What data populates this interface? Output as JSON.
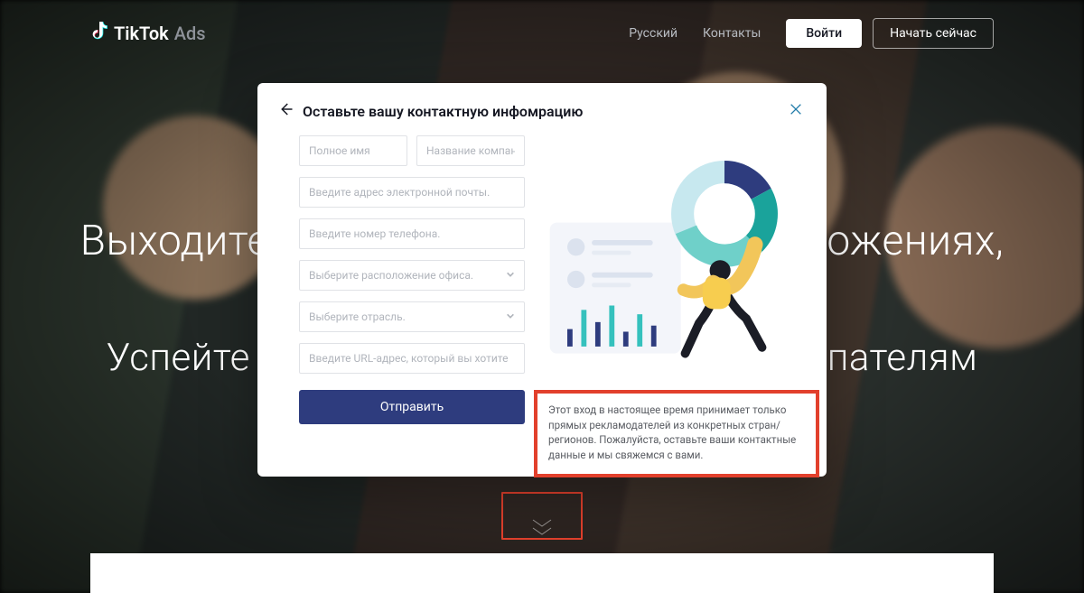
{
  "header": {
    "brand_main": "TikTok",
    "brand_sub": "Ads",
    "lang_link": "Русский",
    "contacts_link": "Контакты",
    "login_label": "Войти",
    "start_label": "Начать сейчас"
  },
  "hero": {
    "line1": "Выходите на новую аудиторию в приложениях,",
    "line2": "Успейте представить  бренд новым покупателям"
  },
  "modal": {
    "title": "Оставьте вашу контактную инфомрацию",
    "placeholders": {
      "full_name": "Полное имя",
      "company": "Название компании",
      "email": "Введите адрес электронной почты.",
      "phone": "Введите номер телефона.",
      "office": "Выберите расположение офиса.",
      "industry": "Выберите отрасль.",
      "url": "Введите URL-адрес, который вы хотите"
    },
    "submit_label": "Отправить"
  },
  "notice": {
    "text": "Этот вход в настоящее время принимает только прямых рекламодателей из конкретных стран/регионов. Пожалуйста, оставьте ваши контактные данные и мы свяжемся с вами."
  }
}
